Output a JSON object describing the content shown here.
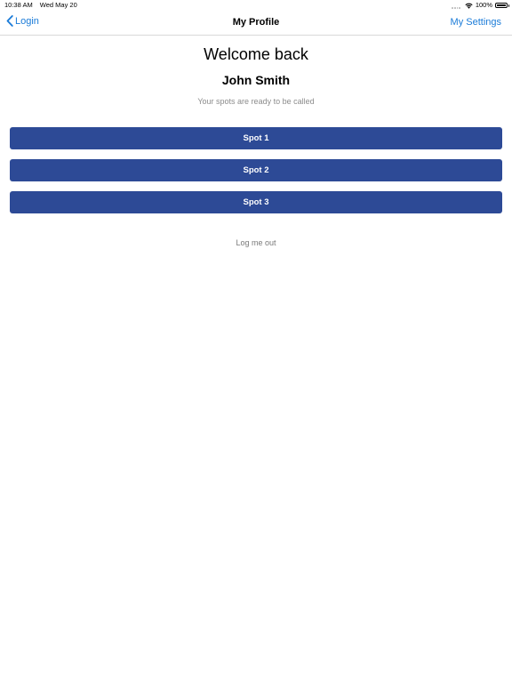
{
  "status_bar": {
    "time": "10:38 AM",
    "date": "Wed May 20",
    "battery": "100%"
  },
  "nav": {
    "back_label": "Login",
    "title": "My Profile",
    "right_label": "My Settings"
  },
  "profile": {
    "greeting": "Welcome back",
    "name": "John Smith",
    "subtitle": "Your spots are ready to be called"
  },
  "spots": [
    {
      "label": "Spot 1"
    },
    {
      "label": "Spot 2"
    },
    {
      "label": "Spot 3"
    }
  ],
  "logout_label": "Log me out",
  "colors": {
    "accent": "#1a7bd8",
    "button": "#2d4a96",
    "muted": "#8c8c8c"
  }
}
